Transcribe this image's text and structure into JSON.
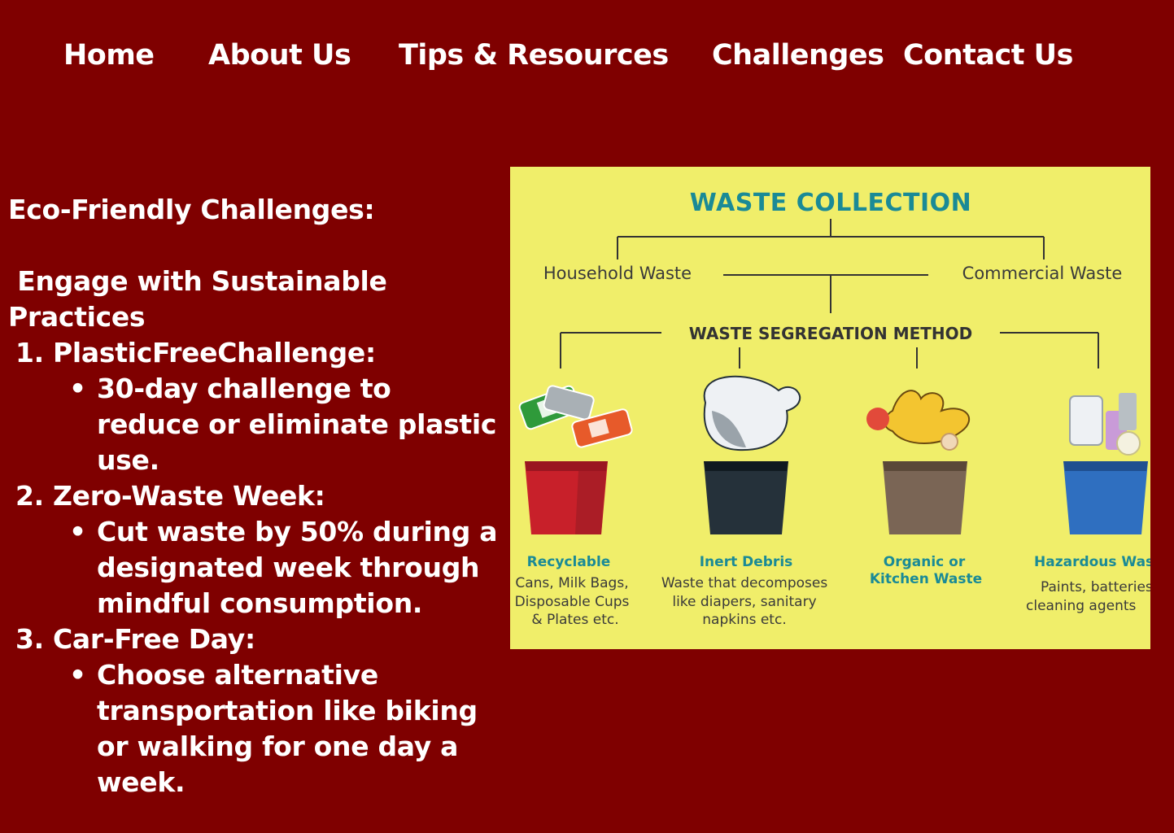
{
  "nav": {
    "items": [
      "Home",
      "About Us",
      "Tips & Resources",
      "Challenges",
      "Contact Us"
    ]
  },
  "content": {
    "heading": "Eco-Friendly Challenges:",
    "subheading": "Engage with Sustainable Practices",
    "challenges": [
      {
        "number": "1.",
        "title": "PlasticFreeChallenge:",
        "detail": "30-day challenge to reduce or eliminate plastic use."
      },
      {
        "number": "2.",
        "title": "Zero-Waste Week:",
        "detail": "Cut waste by 50% during a designated week through mindful consumption."
      },
      {
        "number": "3.",
        "title": "Car-Free Day:",
        "detail": "Choose alternative transportation like biking or walking for one day a week."
      }
    ]
  },
  "figure": {
    "title": "WASTE COLLECTION",
    "branches": [
      "Household Waste",
      "Commercial Waste"
    ],
    "method": "WASTE SEGREGATION METHOD",
    "bins": [
      {
        "label_lines": [
          "Recyclable"
        ],
        "desc_lines": [
          "Cans, Milk Bags,",
          "Disposable Cups",
          "& Plates etc."
        ],
        "color": "#c8202a"
      },
      {
        "label_lines": [
          "Inert Debris"
        ],
        "desc_lines": [
          "Waste that decomposes",
          "like diapers, sanitary",
          "napkins etc."
        ],
        "color": "#25313a"
      },
      {
        "label_lines": [
          "Organic or",
          "Kitchen Waste"
        ],
        "desc_lines": [],
        "color": "#7a6555"
      },
      {
        "label_lines": [
          "Hazardous Waste"
        ],
        "desc_lines": [
          "Paints, batteries,",
          "cleaning agents"
        ],
        "color": "#2f6fc0"
      }
    ]
  }
}
